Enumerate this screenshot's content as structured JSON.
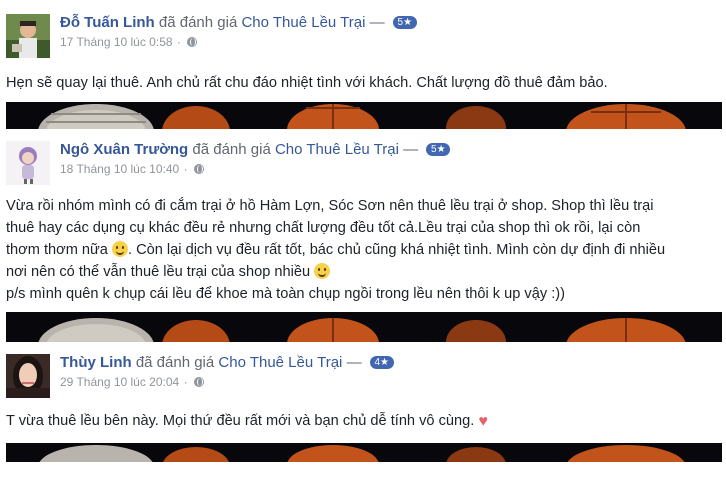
{
  "reviews": [
    {
      "reviewer": "Đỗ Tuấn Linh",
      "action": "đã đánh giá",
      "page_name": "Cho Thuê Lều Trại",
      "dash": "—",
      "rating": "5★",
      "date": "17 Tháng 10 lúc 0:58",
      "separator": "·",
      "privacy_icon": "globe-icon",
      "text": "Hẹn sẽ quay lại thuê. Anh chủ rất chu đáo nhiệt tình với khách. Chất lượng đồ thuê đảm bảo."
    },
    {
      "reviewer": "Ngô Xuân Trường",
      "action": "đã đánh giá",
      "page_name": "Cho Thuê Lều Trại",
      "dash": "—",
      "rating": "5★",
      "date": "18 Tháng 10 lúc 10:40",
      "separator": "·",
      "privacy_icon": "globe-icon",
      "text_lines": [
        "Vừa rồi nhóm mình có đi cắm trại ở hồ Hàm Lợn, Sóc Sơn nên thuê lều trại ở shop. Shop thì lều trại",
        "thuê hay các dụng cụ khác đều rẻ nhưng chất lượng đều tốt cả.Lều trại của shop thì ok rồi, lại còn",
        "thơm thơm nữa",
        ". Còn lại dịch vụ đều rất tốt, bác chủ cũng khá nhiệt tình. Mình còn dự định đi nhiều",
        "nơi nên có thể vẫn thuê lều trại của shop nhiều",
        "p/s mình quên k chụp cái lều để khoe mà toàn chụp ngồi trong lều nên thôi k up vậy :))"
      ]
    },
    {
      "reviewer": "Thùy Linh",
      "action": "đã đánh giá",
      "page_name": "Cho Thuê Lều Trại",
      "dash": "—",
      "rating": "4★",
      "date": "29 Tháng 10 lúc 20:04",
      "separator": "·",
      "privacy_icon": "globe-icon",
      "text": "T vừa thuê lều bên này. Mọi thứ đều rất mới và bạn chủ dễ tính vô cùng.",
      "heart": "♥"
    }
  ],
  "colors": {
    "link": "#365899",
    "meta": "#90949c",
    "badge": "#4267b2",
    "text": "#1d2129",
    "strip_dark": "#07070c",
    "lantern_orange": "#c2541b"
  }
}
